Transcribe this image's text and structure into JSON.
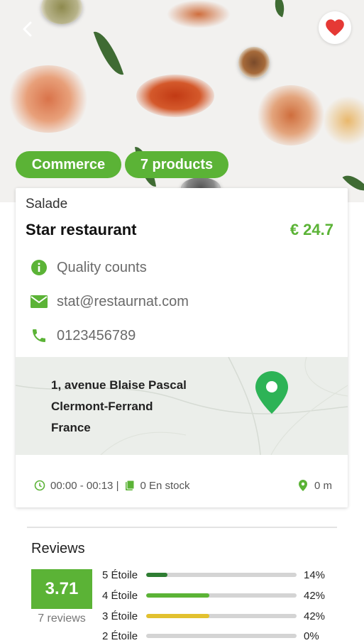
{
  "hero": {
    "back_icon": "chevron-left-icon",
    "favorite_icon": "heart-icon",
    "favorite_color": "#e53935",
    "chips": [
      "Commerce",
      "7 products"
    ]
  },
  "product": {
    "category": "Salade",
    "name": "Star restaurant",
    "price": "€ 24.7",
    "accent_color": "#5bb336",
    "info": [
      {
        "icon": "info-icon",
        "text": "Quality counts"
      },
      {
        "icon": "mail-icon",
        "text": "stat@restaurnat.com"
      },
      {
        "icon": "phone-icon",
        "text": "0123456789"
      }
    ],
    "address": [
      "1, avenue Blaise Pascal",
      "Clermont-Ferrand",
      "France"
    ],
    "hours": "00:00 - 00:13 |",
    "stock": "0 En stock",
    "distance": "0 m"
  },
  "reviews": {
    "title": "Reviews",
    "score": "3.71",
    "count_label": "7 reviews",
    "rows": [
      {
        "label": "5 Étoile",
        "percent": "14%",
        "fraction": 0.14,
        "color": "#2e7d32"
      },
      {
        "label": "4 Étoile",
        "percent": "42%",
        "fraction": 0.42,
        "color": "#5bb336"
      },
      {
        "label": "3 Étoile",
        "percent": "42%",
        "fraction": 0.42,
        "color": "#e2c12f"
      },
      {
        "label": "2 Étoile",
        "percent": "0%",
        "fraction": 0.0,
        "color": "#f39c12"
      }
    ]
  }
}
